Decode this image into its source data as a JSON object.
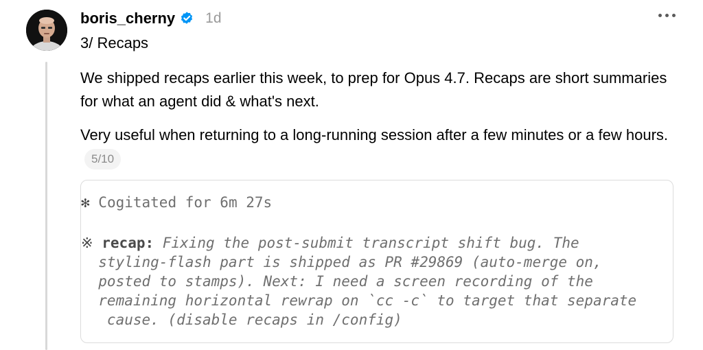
{
  "post": {
    "username": "boris_cherny",
    "verified": true,
    "timestamp": "1d",
    "subtitle": "3/ Recaps",
    "paragraph1": "We shipped recaps earlier this week, to prep for Opus 4.7. Recaps are short summaries for what an agent did & what's next.",
    "paragraph2": "Very useful when returning to a long-running session after a few minutes or a few hours.",
    "thread_counter": "5/10"
  },
  "code": {
    "line1_glyph": "✻",
    "line1_text": " Cogitated for 6m 27s",
    "recap_glyph": "※",
    "recap_label": "recap:",
    "recap_line1": " Fixing the post-submit transcript shift bug. The",
    "recap_line2": "  styling-flash part is shipped as PR #29869 (auto-merge on,",
    "recap_line3": "  posted to stamps). Next: I need a screen recording of the",
    "recap_line4": "  remaining horizontal rewrap on `cc -c` to target that separate",
    "recap_line5": "   cause. (disable recaps in /config)"
  },
  "icons": {
    "verified": "verified-badge-icon",
    "more": "more-options-icon",
    "avatar": "user-avatar"
  },
  "colors": {
    "verified_blue": "#0095f6",
    "timestamp_gray": "#9a9a9a",
    "code_gray": "#6f6f6f"
  }
}
